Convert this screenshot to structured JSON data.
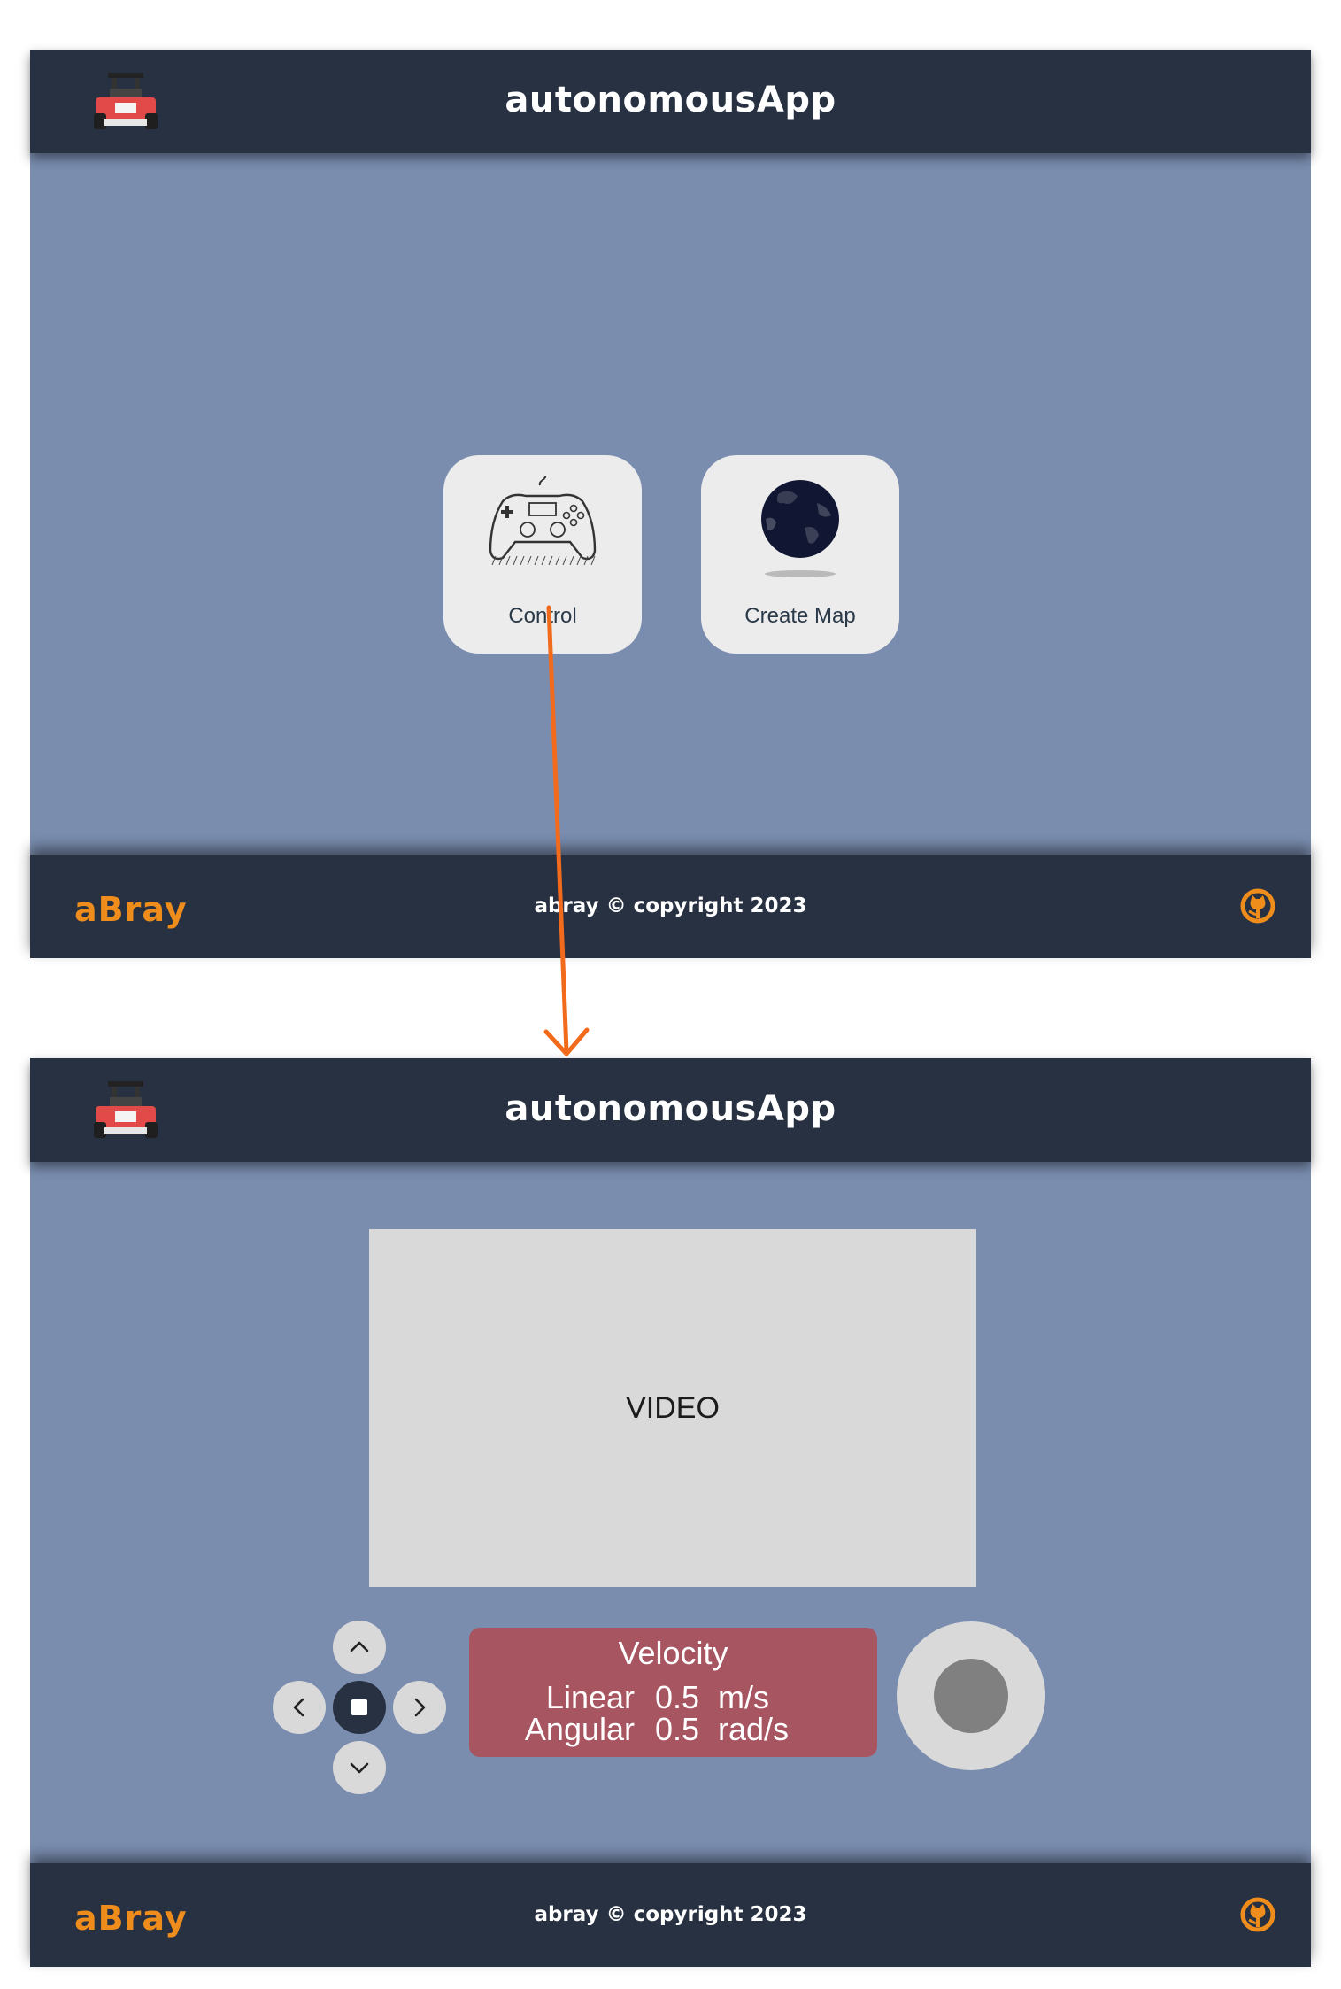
{
  "screens": [
    {
      "header": {
        "title": "autonomousApp",
        "logo_icon": "robot-car-icon"
      },
      "cards": [
        {
          "label": "Control",
          "icon": "gamepad-icon"
        },
        {
          "label": "Create Map",
          "icon": "globe-icon"
        }
      ],
      "footer": {
        "brand": "aBray",
        "copyright": "abray © copyright 2023",
        "icon": "github-icon"
      }
    },
    {
      "header": {
        "title": "autonomousApp",
        "logo_icon": "robot-car-icon"
      },
      "video": {
        "label": "VIDEO"
      },
      "dpad": {
        "icons": [
          "chevron-up-icon",
          "chevron-left-icon",
          "stop-icon",
          "chevron-right-icon",
          "chevron-down-icon"
        ]
      },
      "velocity": {
        "title": "Velocity",
        "linear": {
          "label": "Linear",
          "value": "0.5",
          "unit": "m/s"
        },
        "angular": {
          "label": "Angular",
          "value": "0.5",
          "unit": "rad/s"
        }
      },
      "joystick": {
        "icon": "joystick-icon"
      },
      "footer": {
        "brand": "aBray",
        "copyright": "abray © copyright 2023",
        "icon": "github-icon"
      }
    }
  ],
  "colors": {
    "header_bg": "#283141",
    "main_bg": "#7a8daf",
    "brand": "#ee8d1c",
    "card_bg": "#ececec",
    "velocity_bg": "#a85562",
    "flow_arrow": "#f26a1b"
  }
}
